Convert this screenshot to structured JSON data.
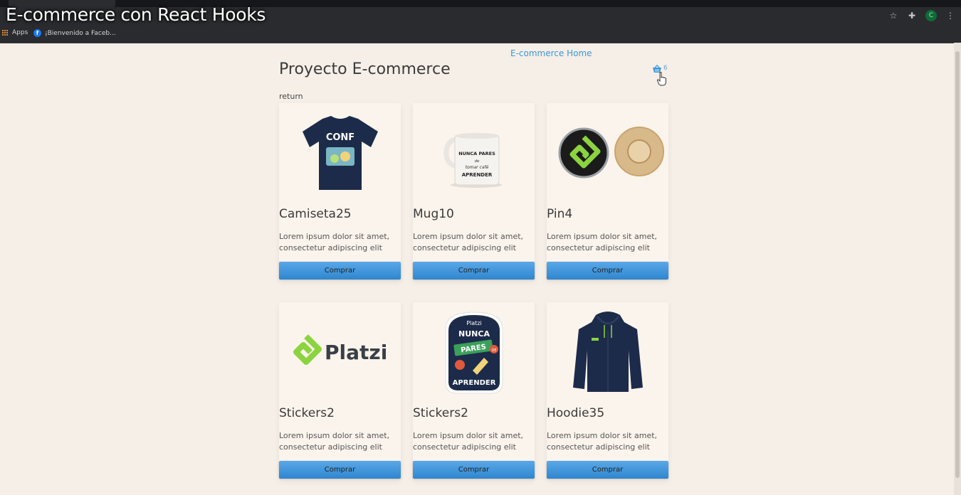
{
  "video_title": "E-commerce con React Hooks",
  "browser": {
    "bookmarks": [
      {
        "label": "Apps",
        "icon": "apps-icon"
      },
      {
        "label": "¡Bienvenido a Faceb...",
        "icon": "facebook-icon"
      }
    ],
    "profile_initial": "C"
  },
  "header": {
    "home_link": "E-commerce Home",
    "title": "Proyecto E-commerce",
    "cart_count": "6",
    "return_text": "return"
  },
  "products": [
    {
      "name": "Camiseta25",
      "description": "Lorem ipsum dolor sit amet, consectetur adipiscing elit",
      "button": "Comprar",
      "image": "tshirt"
    },
    {
      "name": "Mug10",
      "description": "Lorem ipsum dolor sit amet, consectetur adipiscing elit",
      "button": "Comprar",
      "image": "mug"
    },
    {
      "name": "Pin4",
      "description": "Lorem ipsum dolor sit amet, consectetur adipiscing elit",
      "button": "Comprar",
      "image": "pins"
    },
    {
      "name": "Stickers2",
      "description": "Lorem ipsum dolor sit amet, consectetur adipiscing elit",
      "button": "Comprar",
      "image": "sticker-logo"
    },
    {
      "name": "Stickers2",
      "description": "Lorem ipsum dolor sit amet, consectetur adipiscing elit",
      "button": "Comprar",
      "image": "sticker-badge"
    },
    {
      "name": "Hoodie35",
      "description": "Lorem ipsum dolor sit amet, consectetur adipiscing elit",
      "button": "Comprar",
      "image": "hoodie"
    }
  ],
  "image_text": {
    "tshirt": "CONF",
    "mug": "NUNCA PARES de tomar café APRENDER",
    "sticker_logo": "Platzi",
    "badge_top": "Platzi",
    "badge_nunca": "NUNCA",
    "badge_pares": "PARES",
    "badge_de": "DE",
    "badge_aprender": "APRENDER"
  },
  "colors": {
    "accent": "#3b97d9",
    "button": "#3a8fd6",
    "platzi_green": "#8bd43f",
    "navy": "#1d2b4a"
  }
}
